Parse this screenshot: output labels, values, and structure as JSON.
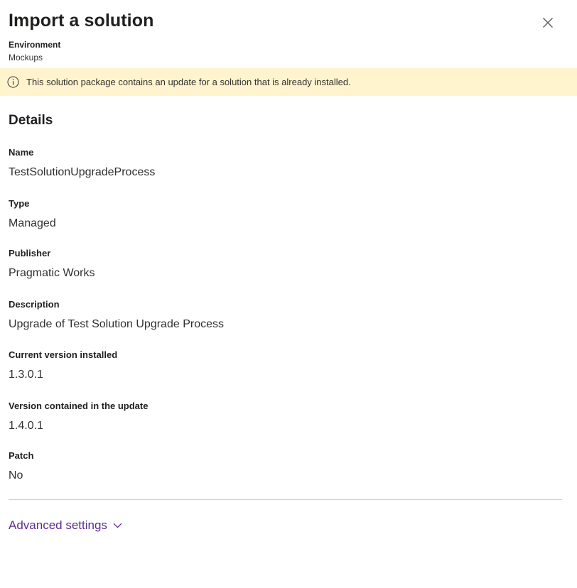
{
  "header": {
    "title": "Import a solution",
    "close_icon": "close-icon"
  },
  "environment": {
    "label": "Environment",
    "value": "Mockups"
  },
  "banner": {
    "icon": "info-icon",
    "text": "This solution package contains an update for a solution that is already installed.",
    "background": "#fff4ce"
  },
  "details": {
    "title": "Details",
    "fields": [
      {
        "label": "Name",
        "value": "TestSolutionUpgradeProcess"
      },
      {
        "label": "Type",
        "value": "Managed"
      },
      {
        "label": "Publisher",
        "value": "Pragmatic Works"
      },
      {
        "label": "Description",
        "value": "Upgrade of Test Solution Upgrade Process"
      },
      {
        "label": "Current version installed",
        "value": "1.3.0.1"
      },
      {
        "label": "Version contained in the update",
        "value": "1.4.0.1"
      },
      {
        "label": "Patch",
        "value": "No"
      }
    ]
  },
  "advanced": {
    "label": "Advanced settings",
    "icon": "chevron-down-icon",
    "color": "#5c2d91"
  }
}
